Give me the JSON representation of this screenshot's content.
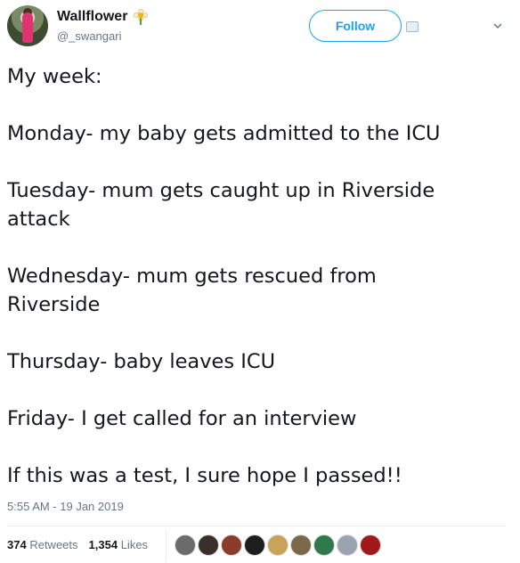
{
  "tweet": {
    "author": {
      "display_name": "Wallflower",
      "handle": "@_swangari",
      "name_emoji": "flower-icon"
    },
    "follow_label": "Follow",
    "lines": [
      "My week:",
      "",
      "Monday- my baby gets admitted to the ICU",
      "",
      "Tuesday- mum gets caught up in Riverside",
      "attack",
      "",
      "Wednesday- mum gets rescued from",
      "Riverside",
      "",
      "Thursday- baby leaves ICU",
      "",
      "Friday- I get called for an interview",
      "",
      "If this was a test, I sure hope I passed!!"
    ],
    "timestamp": "5:55 AM - 19 Jan 2019",
    "retweets_count": "374",
    "retweets_label": "Retweets",
    "likes_count": "1,354",
    "likes_label": "Likes"
  },
  "colors": {
    "accent": "#1da1f2",
    "secondary_text": "#657786",
    "primary_text": "#14171a"
  },
  "liker_avatars": [
    {
      "color": "#6b6b6b"
    },
    {
      "color": "#3a2f2a"
    },
    {
      "color": "#8a3b2a"
    },
    {
      "color": "#1e1e1e"
    },
    {
      "color": "#c9a35a"
    },
    {
      "color": "#7a6a4a"
    },
    {
      "color": "#2f7a4a"
    },
    {
      "color": "#9aa3b0"
    },
    {
      "color": "#a01818"
    }
  ]
}
